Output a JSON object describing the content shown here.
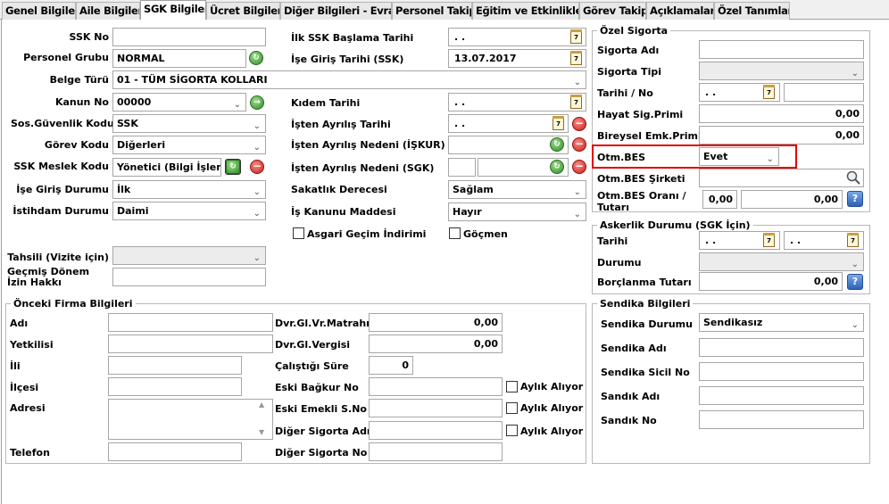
{
  "tabs": [
    {
      "label": "Genel Bilgiler",
      "active": false
    },
    {
      "label": "Aile Bilgileri",
      "active": false
    },
    {
      "label": "SGK Bilgileri",
      "active": true
    },
    {
      "label": "Ücret Bilgileri",
      "active": false
    },
    {
      "label": "Diğer Bilgileri - Evrak",
      "active": false
    },
    {
      "label": "Personel Takip",
      "active": false
    },
    {
      "label": "Eğitim ve Etkinlikler",
      "active": false
    },
    {
      "label": "Görev Takip",
      "active": false
    },
    {
      "label": "Açıklamalar",
      "active": false
    },
    {
      "label": "Özel Tanımlar",
      "active": false
    }
  ],
  "left": {
    "ssk_no": {
      "label": "SSK No",
      "value": ""
    },
    "personel_grubu": {
      "label": "Personel Grubu",
      "value": "NORMAL"
    },
    "belge_turu": {
      "label": "Belge Türü",
      "value": "01 - TÜM SİGORTA KOLLARI"
    },
    "kanun_no": {
      "label": "Kanun No",
      "value": "00000"
    },
    "sos_guvenlik": {
      "label": "Sos.Güvenlik Kodu",
      "value": "SSK"
    },
    "gorev_kodu": {
      "label": "Görev Kodu",
      "value": "Diğerleri"
    },
    "ssk_meslek": {
      "label": "SSK Meslek Kodu",
      "value": "Yönetici (Bilgi İşlem)"
    },
    "ise_giris_durumu": {
      "label": "İşe Giriş Durumu",
      "value": "İlk"
    },
    "istihdam": {
      "label": "İstihdam Durumu",
      "value": "Daimi"
    },
    "tahsili": {
      "label": "Tahsili (Vizite için)",
      "value": ""
    },
    "gecmis_donem": {
      "label": "Geçmiş Dönem İzin Hakkı",
      "value": ""
    }
  },
  "mid": {
    "ilk_ssk": {
      "label": "İlk SSK Başlama Tarihi",
      "value": ". ."
    },
    "ise_giris_tarihi": {
      "label": "İşe Giriş Tarihi (SSK)",
      "value": "13.07.2017"
    },
    "kidem": {
      "label": "Kıdem Tarihi",
      "value": ". ."
    },
    "isten_ayrilis": {
      "label": "İşten Ayrılış Tarihi",
      "value": ". ."
    },
    "ayrilis_iskur": {
      "label": "İşten Ayrılış Nedeni (İŞKUR)",
      "value": ""
    },
    "ayrilis_sgk": {
      "label": "İşten Ayrılış Nedeni (SGK)",
      "value": ""
    },
    "sakatlik": {
      "label": "Sakatlık Derecesi",
      "value": "Sağlam"
    },
    "is_kanunu": {
      "label": "İş Kanunu Maddesi",
      "value": "Hayır"
    },
    "asgari": {
      "label": "Asgari Geçim İndirimi"
    },
    "gocmen": {
      "label": "Göçmen"
    }
  },
  "ozel_sigorta": {
    "title": "Özel Sigorta",
    "sigorta_adi": {
      "label": "Sigorta Adı",
      "value": ""
    },
    "sigorta_tipi": {
      "label": "Sigorta Tipi",
      "value": ""
    },
    "tarihi_no": {
      "label": "Tarihi / No",
      "date": ". .",
      "no": ""
    },
    "hayat": {
      "label": "Hayat Sig.Primi",
      "value": "0,00"
    },
    "bireysel": {
      "label": "Bireysel Emk.Primi",
      "value": "0,00"
    },
    "otm_bes": {
      "label": "Otm.BES",
      "value": "Evet"
    },
    "otm_bes_sirketi": {
      "label": "Otm.BES Şirketi",
      "value": ""
    },
    "otm_bes_orani": {
      "label1": "Otm.BES Oranı /",
      "label2": "Tutarı",
      "oran": "0,00",
      "tutar": "0,00"
    }
  },
  "askerlik": {
    "title": "Askerlik Durumu (SGK İçin)",
    "tarihi": {
      "label": "Tarihi",
      "v1": ". .",
      "v2": ". ."
    },
    "durumu": {
      "label": "Durumu",
      "value": ""
    },
    "borclanma": {
      "label": "Borçlanma Tutarı",
      "value": "0,00"
    }
  },
  "onceki_firma": {
    "title": "Önceki Firma Bilgileri",
    "adi": {
      "label": "Adı",
      "value": ""
    },
    "yetkilisi": {
      "label": "Yetkilisi",
      "value": ""
    },
    "ili": {
      "label": "İli",
      "value": ""
    },
    "ilcesi": {
      "label": "İlçesi",
      "value": ""
    },
    "adresi": {
      "label": "Adresi",
      "value": ""
    },
    "telefon": {
      "label": "Telefon",
      "value": ""
    },
    "matrah": {
      "label": "Dvr.Gl.Vr.Matrahı",
      "value": "0,00"
    },
    "vergisi": {
      "label": "Dvr.Gl.Vergisi",
      "value": "0,00"
    },
    "calistigi": {
      "label": "Çalıştığı Süre",
      "value": "0"
    },
    "bagkur": {
      "label": "Eski Bağkur No",
      "value": ""
    },
    "emekli": {
      "label": "Eski Emekli S.No",
      "value": ""
    },
    "diger_adi": {
      "label": "Diğer Sigorta Adı",
      "value": ""
    },
    "diger_no": {
      "label": "Diğer Sigorta No",
      "value": ""
    },
    "aylik_aliyor": "Aylık Alıyor"
  },
  "sendika": {
    "title": "Sendika Bilgileri",
    "durumu": {
      "label": "Sendika Durumu",
      "value": "Sendikasız"
    },
    "adi": {
      "label": "Sendika Adı",
      "value": ""
    },
    "sicil": {
      "label": "Sendika Sicil No",
      "value": ""
    },
    "sandik_adi": {
      "label": "Sandık Adı",
      "value": ""
    },
    "sandik_no": {
      "label": "Sandık No",
      "value": ""
    }
  },
  "icons": {
    "calendar": "calendar-icon",
    "refresh": "refresh-icon",
    "delete": "delete-icon",
    "search": "search-icon",
    "help": "help-icon",
    "dropdown": "chevron-down-icon"
  },
  "colors": {
    "highlight": "#e00000"
  }
}
